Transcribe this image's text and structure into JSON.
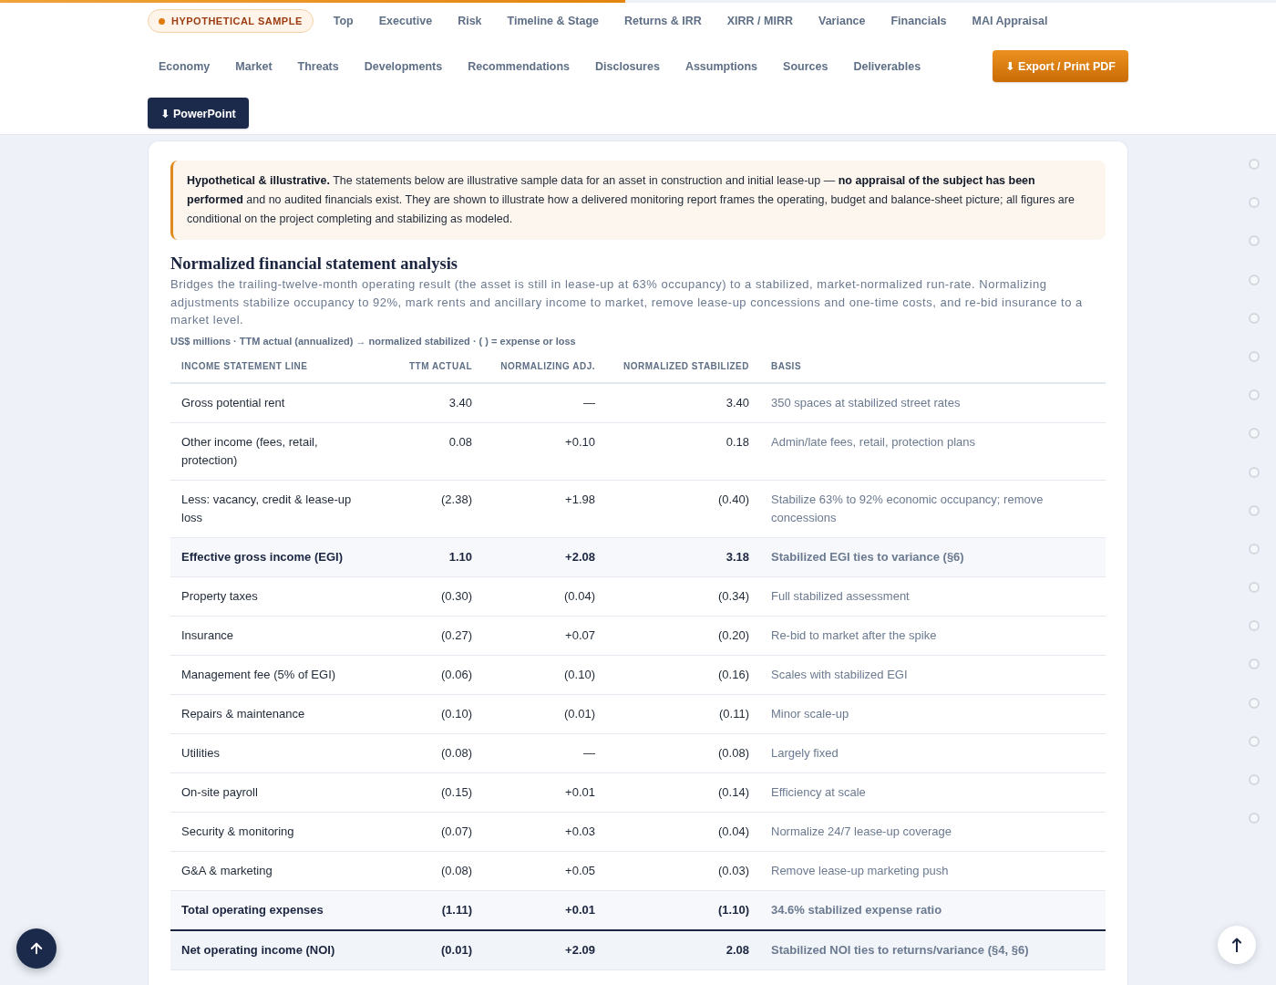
{
  "reading_progress": {
    "level": 0.49
  },
  "header": {
    "rows": [
      {
        "items": [
          {
            "kind": "badge",
            "label": "HYPOTHETICAL SAMPLE"
          },
          {
            "kind": "link",
            "label": "Top"
          },
          {
            "kind": "link",
            "label": "Executive"
          },
          {
            "kind": "link",
            "label": "Risk"
          },
          {
            "kind": "link",
            "label": "Timeline & Stage"
          },
          {
            "kind": "link",
            "label": "Returns & IRR"
          },
          {
            "kind": "link",
            "label": "XIRR / MIRR"
          },
          {
            "kind": "link",
            "label": "Variance"
          },
          {
            "kind": "link",
            "label": "Financials"
          },
          {
            "kind": "link",
            "label": "MAI Appraisal"
          }
        ]
      },
      {
        "items": [
          {
            "kind": "link",
            "label": "Economy"
          },
          {
            "kind": "link",
            "label": "Market"
          },
          {
            "kind": "link",
            "label": "Threats"
          },
          {
            "kind": "link",
            "label": "Developments"
          },
          {
            "kind": "link",
            "label": "Recommendations"
          },
          {
            "kind": "link",
            "label": "Disclosures"
          },
          {
            "kind": "link",
            "label": "Assumptions"
          },
          {
            "kind": "link",
            "label": "Sources"
          },
          {
            "kind": "link",
            "label": "Deliverables"
          },
          {
            "kind": "primary",
            "label": "⬇ Export / Print PDF"
          }
        ]
      },
      {
        "items": [
          {
            "kind": "dark",
            "label": "⬇ PowerPoint"
          }
        ]
      }
    ]
  },
  "notice": {
    "text": "**Hypothetical & illustrative.** The statements below are illustrative sample data for an asset in construction and initial lease-up — **no appraisal of the subject has been performed** and no audited financials exist. They are shown to illustrate how a delivered monitoring report frames the operating, budget and balance-sheet picture; all figures are conditional on the project completing and stabilizing as modeled."
  },
  "section": {
    "title": "Normalized financial statement analysis",
    "description": "Bridges the trailing-twelve-month operating result (the asset is still in lease-up at 63% occupancy) to a stabilized, market-normalized run-rate. Normalizing adjustments stabilize occupancy to 92%, mark rents and ancillary income to market, remove lease-up concessions and one-time costs, and re-bid insurance to a market level.",
    "units_note": "US$ millions · TTM actual (annualized) → normalized stabilized · ( ) = expense or loss",
    "table": {
      "columns": [
        {
          "label": "INCOME STATEMENT LINE",
          "kind": "text"
        },
        {
          "label": "TTM ACTUAL",
          "kind": "number"
        },
        {
          "label": "NORMALIZING ADJ.",
          "kind": "number"
        },
        {
          "label": "NORMALIZED STABILIZED",
          "kind": "number"
        },
        {
          "label": "BASIS",
          "kind": "note"
        }
      ],
      "rows": [
        {
          "kind": "line",
          "cells": [
            "Gross potential rent",
            "3.40",
            "—",
            "3.40",
            "350 spaces at stabilized street rates"
          ]
        },
        {
          "kind": "line",
          "cells": [
            "Other income (fees, retail, protection)",
            "0.08",
            "+0.10",
            "0.18",
            "Admin/late fees, retail, protection plans"
          ]
        },
        {
          "kind": "line",
          "cells": [
            "Less: vacancy, credit & lease-up loss",
            "(2.38)",
            "+1.98",
            "(0.40)",
            "Stabilize 63% to 92% economic occupancy; remove concessions"
          ]
        },
        {
          "kind": "subtotal",
          "cells": [
            "Effective gross income (EGI)",
            "1.10",
            "+2.08",
            "3.18",
            "Stabilized EGI ties to variance (§6)"
          ]
        },
        {
          "kind": "line",
          "cells": [
            "Property taxes",
            "(0.30)",
            "(0.04)",
            "(0.34)",
            "Full stabilized assessment"
          ]
        },
        {
          "kind": "line",
          "cells": [
            "Insurance",
            "(0.27)",
            "+0.07",
            "(0.20)",
            "Re-bid to market after the spike"
          ]
        },
        {
          "kind": "line",
          "cells": [
            "Management fee (5% of EGI)",
            "(0.06)",
            "(0.10)",
            "(0.16)",
            "Scales with stabilized EGI"
          ]
        },
        {
          "kind": "line",
          "cells": [
            "Repairs & maintenance",
            "(0.10)",
            "(0.01)",
            "(0.11)",
            "Minor scale-up"
          ]
        },
        {
          "kind": "line",
          "cells": [
            "Utilities",
            "(0.08)",
            "—",
            "(0.08)",
            "Largely fixed"
          ]
        },
        {
          "kind": "line",
          "cells": [
            "On-site payroll",
            "(0.15)",
            "+0.01",
            "(0.14)",
            "Efficiency at scale"
          ]
        },
        {
          "kind": "line",
          "cells": [
            "Security & monitoring",
            "(0.07)",
            "+0.03",
            "(0.04)",
            "Normalize 24/7 lease-up coverage"
          ]
        },
        {
          "kind": "line",
          "cells": [
            "G&A & marketing",
            "(0.08)",
            "+0.05",
            "(0.03)",
            "Remove lease-up marketing push"
          ]
        },
        {
          "kind": "subtotal",
          "cells": [
            "Total operating expenses",
            "(1.11)",
            "+0.01",
            "(1.10)",
            "34.6% stabilized expense ratio"
          ]
        },
        {
          "kind": "total",
          "cells": [
            "Net operating income (NOI)",
            "(0.01)",
            "+2.09",
            "2.08",
            "Stabilized NOI ties to returns/variance (§4, §6)"
          ]
        }
      ]
    }
  },
  "section_dots": [
    {
      "selected": false
    },
    {
      "selected": false
    },
    {
      "selected": false
    },
    {
      "selected": false
    },
    {
      "selected": false
    },
    {
      "selected": false
    },
    {
      "selected": false
    },
    {
      "selected": false
    },
    {
      "selected": false
    },
    {
      "selected": false
    },
    {
      "selected": false
    },
    {
      "selected": false
    },
    {
      "selected": false
    },
    {
      "selected": false
    },
    {
      "selected": false
    },
    {
      "selected": false
    },
    {
      "selected": false
    },
    {
      "selected": false
    }
  ]
}
